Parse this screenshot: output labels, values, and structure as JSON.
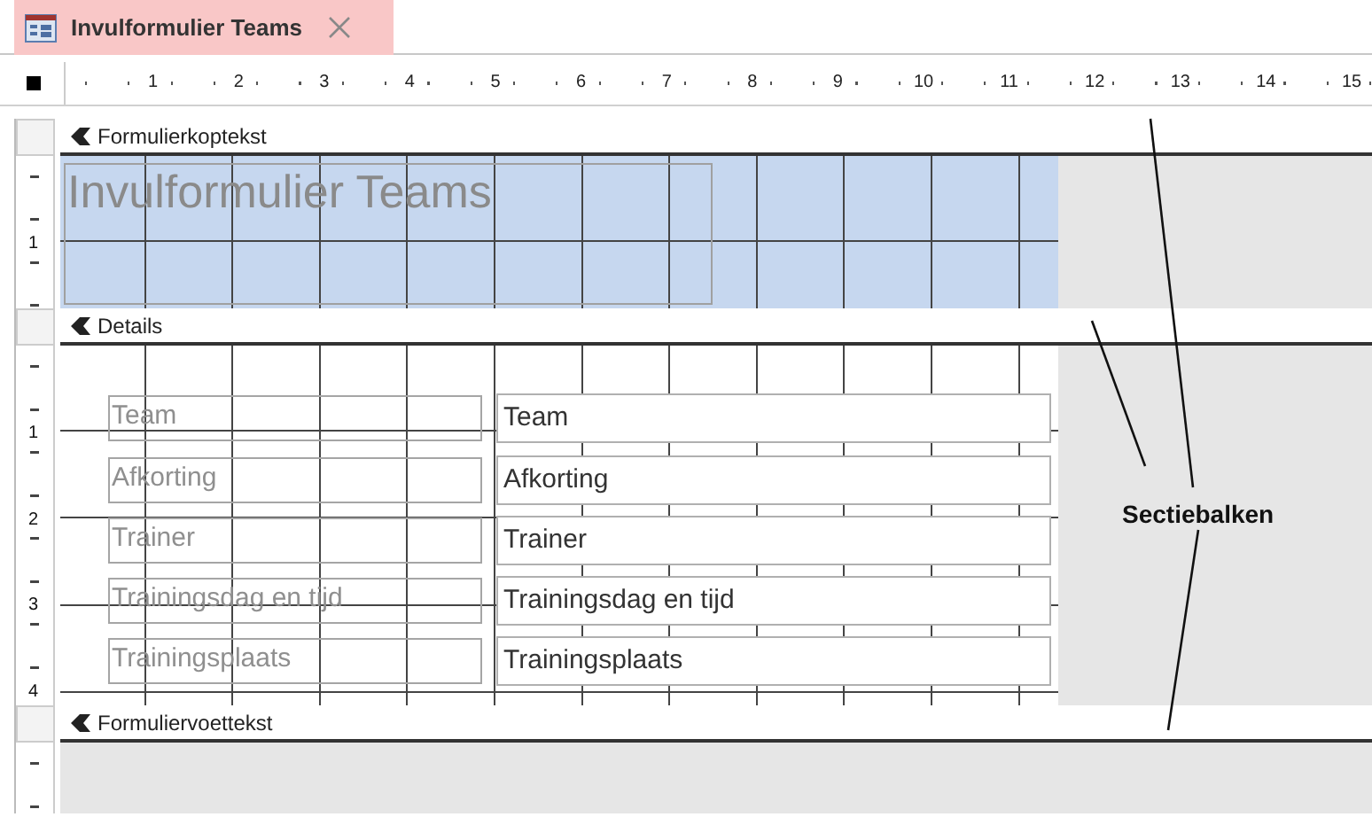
{
  "tab": {
    "title": "Invulformulier Teams",
    "selected": true
  },
  "ruler": {
    "marks": [
      "1",
      "2",
      "3",
      "4",
      "5",
      "6",
      "7",
      "8",
      "9",
      "10",
      "11",
      "12",
      "13",
      "14",
      "15"
    ]
  },
  "sections": [
    {
      "kind": "header",
      "title": "Formulierkoptekst",
      "ruler_marks": [
        "1"
      ],
      "title_label": "Invulformulier Teams"
    },
    {
      "kind": "detail",
      "title": "Details",
      "ruler_marks": [
        "1",
        "2",
        "3",
        "4"
      ],
      "fields": [
        {
          "label": "Team",
          "textbox": "Team"
        },
        {
          "label": "Afkorting",
          "textbox": "Afkorting"
        },
        {
          "label": "Trainer",
          "textbox": "Trainer"
        },
        {
          "label": "Trainingsdag en tijd",
          "textbox": "Trainingsdag en tijd"
        },
        {
          "label": "Trainingsplaats",
          "textbox": "Trainingsplaats"
        }
      ]
    },
    {
      "kind": "footer",
      "title": "Formuliervoettekst"
    }
  ],
  "annotation": {
    "text": "Sectiebalken"
  }
}
